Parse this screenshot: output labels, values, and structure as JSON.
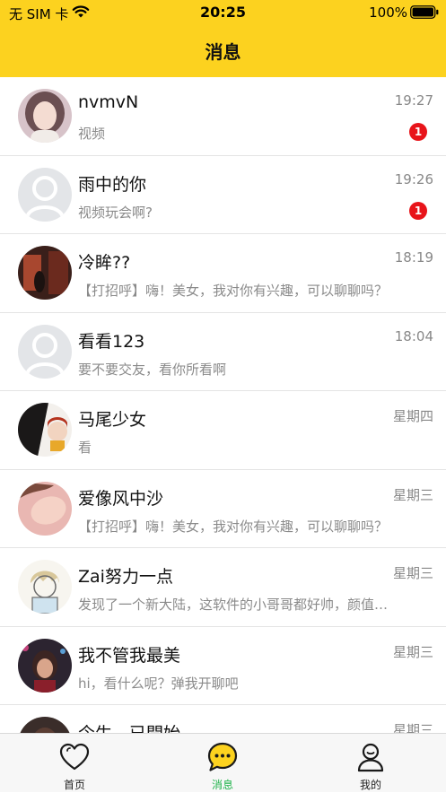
{
  "status_bar": {
    "carrier": "无 SIM 卡",
    "time": "20:25",
    "battery": "100%"
  },
  "header": {
    "title": "消息"
  },
  "conversations": [
    {
      "name": "nvmvN",
      "time": "19:27",
      "preview": "视频",
      "badge": "1"
    },
    {
      "name": "雨中的你",
      "time": "19:26",
      "preview": "视频玩会啊?",
      "badge": "1"
    },
    {
      "name": "冷眸??",
      "time": "18:19",
      "preview": "【打招呼】嗨！美女，我对你有兴趣，可以聊聊吗？"
    },
    {
      "name": "看看123",
      "time": "18:04",
      "preview": "要不要交友，看你所看啊"
    },
    {
      "name": "马尾少女",
      "time": "星期四",
      "preview": "看"
    },
    {
      "name": "爱像风中沙",
      "time": "星期三",
      "preview": "【打招呼】嗨！美女，我对你有兴趣，可以聊聊吗？"
    },
    {
      "name": "Zai努力一点",
      "time": "星期三",
      "preview": "发现了一个新大陆，这软件的小哥哥都好帅，颜值好高"
    },
    {
      "name": "我不管我最美",
      "time": "星期三",
      "preview": "hi，看什么呢？弹我开聊吧"
    },
    {
      "name": "今生，已開始",
      "time": "星期三",
      "preview": ""
    }
  ],
  "tabbar": {
    "items": [
      {
        "label": "首页",
        "icon": "heart-icon"
      },
      {
        "label": "消息",
        "icon": "chat-bubble-icon",
        "active": true
      },
      {
        "label": "我的",
        "icon": "profile-icon"
      }
    ],
    "accent_color": "#fcd21f",
    "active_label_color": "#1fb34a"
  },
  "colors": {
    "header_bg": "#fcd21f",
    "badge": "#e8141a"
  }
}
